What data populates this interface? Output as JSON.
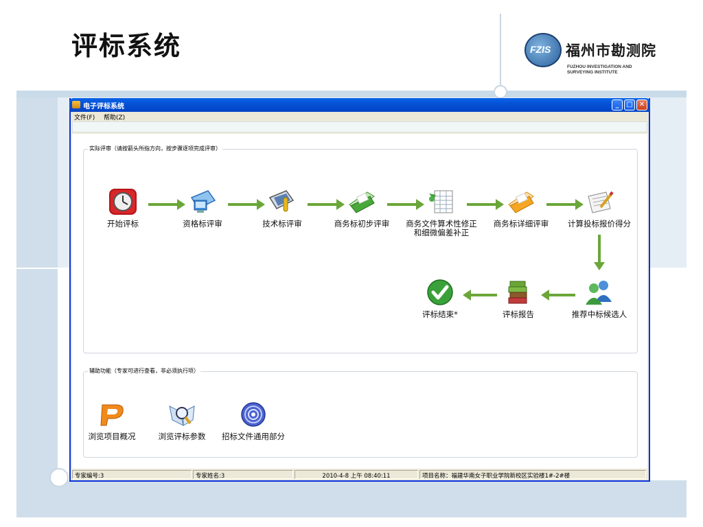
{
  "slide": {
    "title": "评标系统",
    "logo": {
      "mark_text": "FZIS",
      "name_cn": "福州市勘测院",
      "name_en": "FUZHOU INVESTIGATION AND\nSURVEYING INSTITUTE"
    }
  },
  "window": {
    "title": "电子评标系统",
    "menu": [
      "文件(F)",
      "帮助(Z)"
    ],
    "controls": {
      "minimize": "_",
      "maximize": "□",
      "close": "✕"
    }
  },
  "main_group": {
    "label": "实际评审（请按箭头所指方向，按步骤逐项完成评审）",
    "steps": [
      {
        "label": "开始评标",
        "icon": "clock-icon"
      },
      {
        "label": "资格标评审",
        "icon": "monitor-icon"
      },
      {
        "label": "技术标评审",
        "icon": "tech-disk-icon"
      },
      {
        "label": "商务标初步评审",
        "icon": "green-folder-icon"
      },
      {
        "label": "商务文件算术性修正\n和细微偏差补正",
        "icon": "spreadsheet-icon"
      },
      {
        "label": "商务标详细评审",
        "icon": "orange-folder-icon"
      },
      {
        "label": "计算投标报价得分",
        "icon": "pen-paper-icon"
      },
      {
        "label": "推荐中标候选人",
        "icon": "users-icon"
      },
      {
        "label": "评标报告",
        "icon": "books-icon"
      },
      {
        "label": "评标结束*",
        "icon": "checkmark-icon"
      }
    ]
  },
  "aux_group": {
    "label": "辅助功能（专家可进行查看，非必须执行项）",
    "items": [
      {
        "label": "浏览项目概况",
        "icon": "p-logo-icon"
      },
      {
        "label": "浏览评标参数",
        "icon": "magnifier-icon"
      },
      {
        "label": "招标文件通用部分",
        "icon": "disc-icon"
      }
    ]
  },
  "statusbar": {
    "expert_id": "专家编号:3",
    "expert_name": "专家姓名:3",
    "datetime": "2010-4-8 上午 08:40:11",
    "project": "项目名称：福建华南女子职业学院新校区实验楼1#-2#楼"
  },
  "colors": {
    "arrow": "#6aa638",
    "titlebar": "#0552d6"
  }
}
